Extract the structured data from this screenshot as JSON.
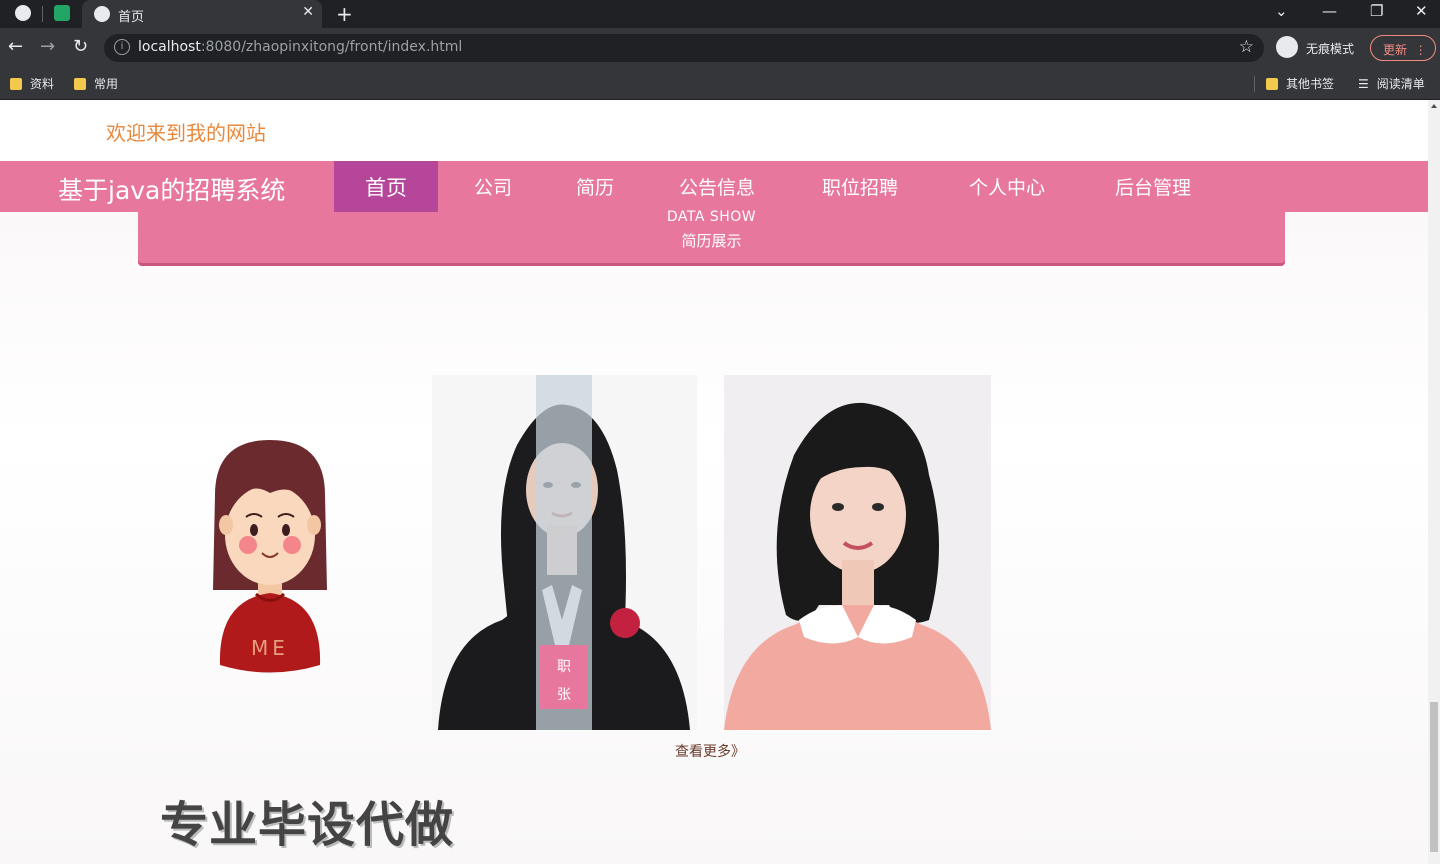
{
  "browser": {
    "tab_title": "首页",
    "url_host": "localhost",
    "url_rest": ":8080/zhaopinxitong/front/index.html",
    "incognito_label": "无痕模式",
    "update_label": "更新",
    "bookmarks": [
      "资料",
      "常用"
    ],
    "bookmarks_right": [
      "其他书签",
      "阅读清单"
    ]
  },
  "site": {
    "welcome": "欢迎来到我的网站",
    "brand": "基于java的招聘系统",
    "nav": [
      "首页",
      "公司",
      "简历",
      "公告信息",
      "职位招聘",
      "个人中心",
      "后台管理"
    ],
    "active_nav": "首页",
    "section_en": "DATA SHOW",
    "section_cn": "简历展示",
    "overlay_label_1": "职",
    "overlay_label_2": "张",
    "cartoon_shirt_text": "ME",
    "more_link": "查看更多》",
    "slogan": "专业毕设代做"
  },
  "colors": {
    "nav_bg": "#e7779c",
    "nav_active": "#b5469a",
    "welcome_text": "#e8883d"
  }
}
